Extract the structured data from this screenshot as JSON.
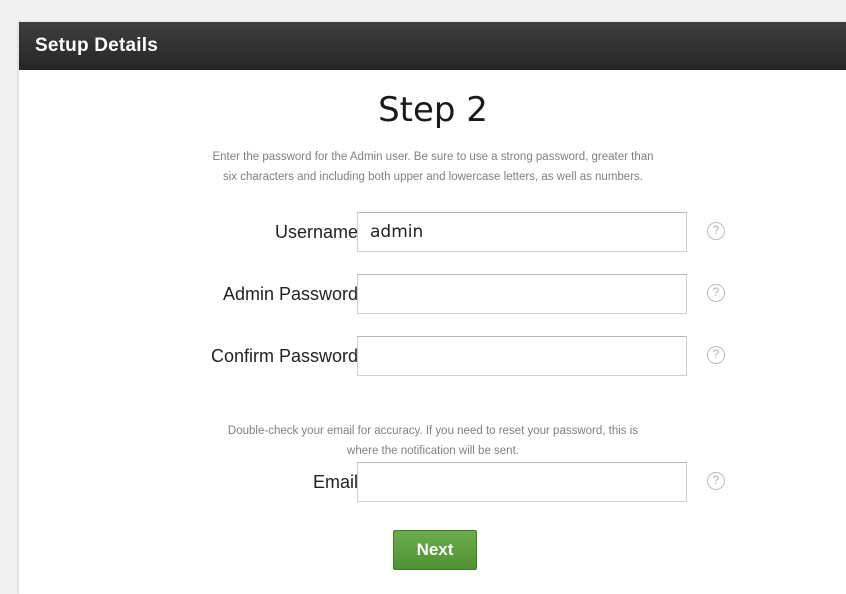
{
  "panel": {
    "header_title": "Setup Details"
  },
  "step": {
    "title": "Step 2",
    "description": "Enter the password for the Admin user. Be sure to use a strong password, greater than\nsix characters and including both upper and lowercase letters, as well as numbers."
  },
  "fields": {
    "username": {
      "label": "Username:",
      "value": "admin",
      "placeholder": ""
    },
    "admin_password": {
      "label": "Admin Password:",
      "value": "",
      "placeholder": ""
    },
    "confirm_password": {
      "label": "Confirm Password:",
      "value": "",
      "placeholder": ""
    },
    "email": {
      "label": "Email:",
      "value": "",
      "placeholder": ""
    }
  },
  "email_note": "Double-check your email for accuracy. If you need to reset your password, this is\nwhere the notification will be sent.",
  "help_icon_glyph": "?",
  "next_button": {
    "label": "Next"
  },
  "colors": {
    "header_bg": "#2e2e2e",
    "button_green": "#5a9e3f",
    "help_gray": "#bcbcbc"
  }
}
